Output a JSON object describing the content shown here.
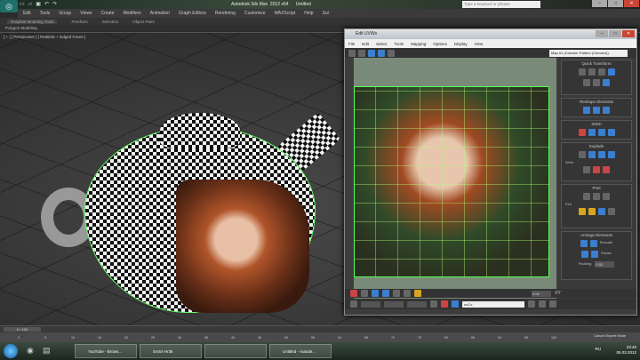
{
  "app": {
    "title": "Autodesk 3ds Max  2012 x64      Untitled",
    "search_placeholder": "Type a keyword or phrase",
    "logo": "3ds"
  },
  "quick_access": [
    "new",
    "open",
    "save",
    "undo",
    "redo"
  ],
  "menu": [
    "Edit",
    "Tools",
    "Group",
    "Views",
    "Create",
    "Modifiers",
    "Animation",
    "Graph Editors",
    "Rendering",
    "Customize",
    "MAXScript",
    "Help",
    "Sul"
  ],
  "ribbon": {
    "tabs": [
      "Graphite Modeling Tools",
      "Freeform",
      "Selection",
      "Object Paint"
    ],
    "panel": "Polygon Modeling"
  },
  "viewport": {
    "label": "[ + ] [ Perspective ] [ Realistic + Edged Faces ]"
  },
  "uv_editor": {
    "title": "Edit UVWs",
    "menu": [
      "File",
      "Edit",
      "Select",
      "Tools",
      "Mapping",
      "Options",
      "Display",
      "View"
    ],
    "uv_label": "UV",
    "map_select": "Map #1 (Checker Pattern (Checker))",
    "sections": {
      "quick_transform": "Quick Transform",
      "reshape": "Reshape Elements",
      "stitch": "Stitch",
      "explode": "Explode",
      "weld": "Weld",
      "peel": "Peel",
      "pelt": "Pelt",
      "arrange": "Arrange Elements",
      "rescale": "Rescale",
      "rotate": "Rotate",
      "padding_label": "Padding:",
      "padding_value": "0.02"
    },
    "bottom": {
      "xy": "XY",
      "value": "0.00",
      "channel": "uvCo"
    }
  },
  "timeline": {
    "position": "0 / 100",
    "ticks": [
      "0",
      "5",
      "10",
      "15",
      "20",
      "25",
      "30",
      "35",
      "40",
      "45",
      "50",
      "55",
      "60",
      "65",
      "70",
      "75",
      "80",
      "85",
      "90",
      "95",
      "100"
    ],
    "status": "Cancel Expert Mode"
  },
  "taskbar": {
    "items": [
      "YouTube - Brows...",
      "SASA Hr3k",
      "",
      "Untitled - Autode..."
    ],
    "lang": "RU",
    "time": "23:40",
    "date": "06.03.2012"
  }
}
